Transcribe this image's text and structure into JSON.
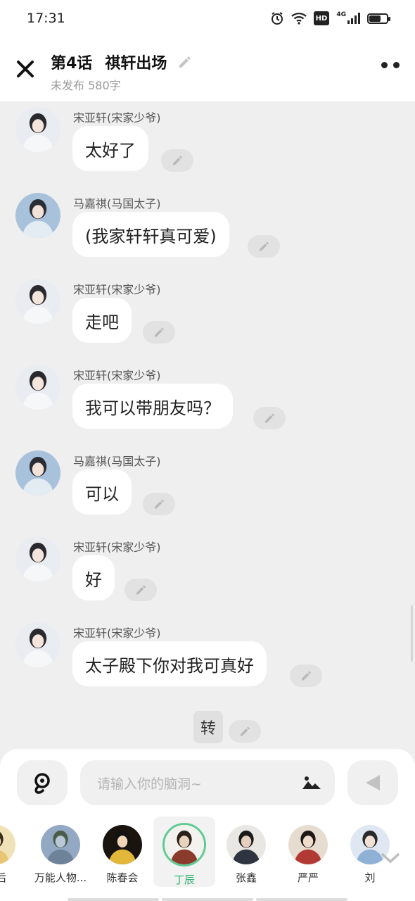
{
  "status": {
    "time": "17:31",
    "hd": "HD",
    "net": "4G",
    "battery_level": 0.65
  },
  "header": {
    "episode": "第4话",
    "title": "祺轩出场",
    "subtitle": "未发布 580字"
  },
  "messages": [
    {
      "speaker": "宋亚轩(宋家少爷)",
      "text": "太好了",
      "avatar": "song"
    },
    {
      "speaker": "马嘉祺(马国太子)",
      "text": "(我家轩轩真可爱)",
      "avatar": "ma"
    },
    {
      "speaker": "宋亚轩(宋家少爷)",
      "text": "走吧",
      "avatar": "song"
    },
    {
      "speaker": "宋亚轩(宋家少爷)",
      "text": "我可以带朋友吗？",
      "avatar": "song"
    },
    {
      "speaker": "马嘉祺(马国太子)",
      "text": "可以",
      "avatar": "ma"
    },
    {
      "speaker": "宋亚轩(宋家少爷)",
      "text": "好",
      "avatar": "song"
    },
    {
      "speaker": "宋亚轩(宋家少爷)",
      "text": "太子殿下你对我可真好",
      "avatar": "song"
    }
  ],
  "narration": {
    "text": "转"
  },
  "input": {
    "placeholder": "请输入你的脑洞~"
  },
  "characters": [
    {
      "name": "皇后",
      "avatar": "gold",
      "selected": false
    },
    {
      "name": "万能人物...",
      "avatar": "lake",
      "selected": false
    },
    {
      "name": "陈春会",
      "avatar": "emperor",
      "selected": false
    },
    {
      "name": "丁辰",
      "avatar": "warrior",
      "selected": true
    },
    {
      "name": "张鑫",
      "avatar": "dark",
      "selected": false
    },
    {
      "name": "严严",
      "avatar": "red",
      "selected": false
    },
    {
      "name": "刘",
      "avatar": "blue",
      "selected": false
    }
  ],
  "colors": {
    "accent": "#5ecb94",
    "accent_text": "#2fb36e",
    "chat_bg": "#efefef"
  }
}
